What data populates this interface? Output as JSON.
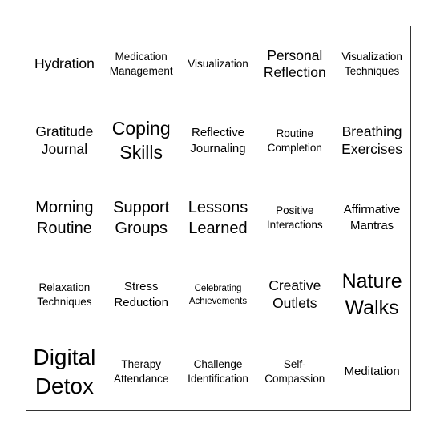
{
  "board": {
    "cells": [
      {
        "text": "Hydration",
        "size": "s17"
      },
      {
        "text": "Medication\nManagement",
        "size": "s13"
      },
      {
        "text": "Visualization",
        "size": "s13"
      },
      {
        "text": "Personal\nReflection",
        "size": "s17"
      },
      {
        "text": "Visualization\nTechniques",
        "size": "s13"
      },
      {
        "text": "Gratitude\nJournal",
        "size": "s17"
      },
      {
        "text": "Coping\nSkills",
        "size": "s22"
      },
      {
        "text": "Reflective\nJournaling",
        "size": "s15"
      },
      {
        "text": "Routine\nCompletion",
        "size": "s13"
      },
      {
        "text": "Breathing\nExercises",
        "size": "s17"
      },
      {
        "text": "Morning\nRoutine",
        "size": "s20"
      },
      {
        "text": "Support\nGroups",
        "size": "s20"
      },
      {
        "text": "Lessons\nLearned",
        "size": "s20"
      },
      {
        "text": "Positive\nInteractions",
        "size": "s13"
      },
      {
        "text": "Affirmative\nMantras",
        "size": "s15"
      },
      {
        "text": "Relaxation\nTechniques",
        "size": "s13"
      },
      {
        "text": "Stress\nReduction",
        "size": "s15"
      },
      {
        "text": "Celebrating\nAchievements",
        "size": "s11"
      },
      {
        "text": "Creative\nOutlets",
        "size": "s17"
      },
      {
        "text": "Nature\nWalks",
        "size": "s25"
      },
      {
        "text": "Digital\nDetox",
        "size": "s28"
      },
      {
        "text": "Therapy\nAttendance",
        "size": "s13"
      },
      {
        "text": "Challenge\nIdentification",
        "size": "s13"
      },
      {
        "text": "Self-\nCompassion",
        "size": "s13"
      },
      {
        "text": "Meditation",
        "size": "s15"
      }
    ]
  }
}
